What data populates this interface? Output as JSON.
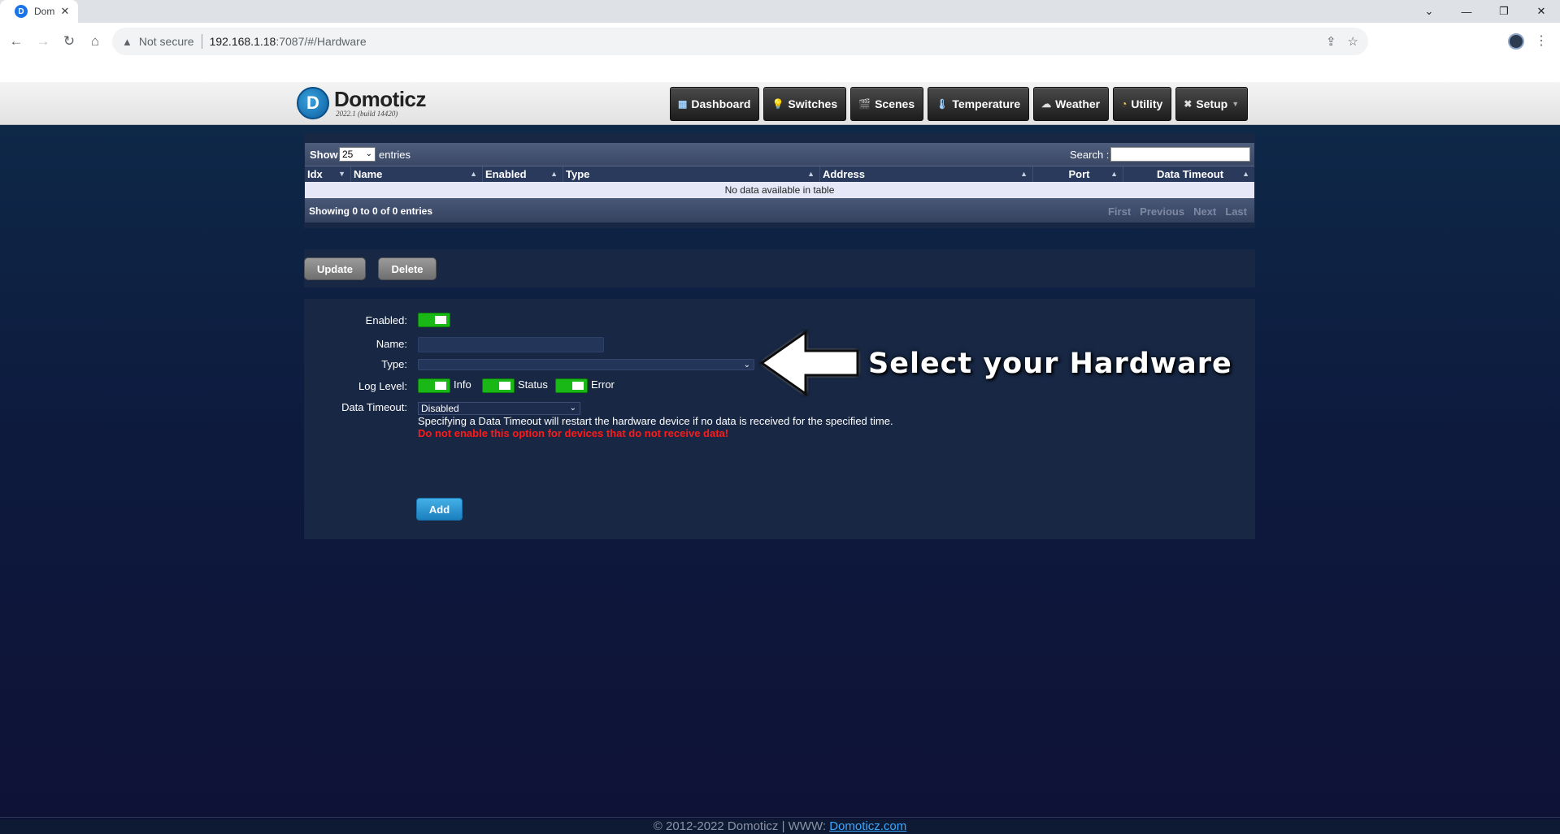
{
  "browser": {
    "tab_title": "Dom",
    "tab_favicon": "D",
    "security_label": "Not secure",
    "url_host": "192.168.1.18",
    "url_path": ":7087/#/Hardware",
    "window_controls": [
      "⌄",
      "—",
      "❐",
      "✕"
    ]
  },
  "header": {
    "logo_mark": "D",
    "logo_name": "Domoticz",
    "version": "2022.1 (build 14420)",
    "menu": [
      {
        "label": "Dashboard",
        "icon": "dashboard-icon",
        "glyph": "▦"
      },
      {
        "label": "Switches",
        "icon": "lightbulb-icon",
        "glyph": "💡"
      },
      {
        "label": "Scenes",
        "icon": "clapperboard-icon",
        "glyph": "🎬"
      },
      {
        "label": "Temperature",
        "icon": "thermometer-icon",
        "glyph": "🌡"
      },
      {
        "label": "Weather",
        "icon": "cloud-icon",
        "glyph": "☁"
      },
      {
        "label": "Utility",
        "icon": "gauge-icon",
        "glyph": "◔"
      },
      {
        "label": "Setup",
        "icon": "tools-icon",
        "glyph": "✖"
      }
    ]
  },
  "table": {
    "show_label": "Show",
    "page_size": "25",
    "entries_label": "entries",
    "search_label": "Search :",
    "columns": [
      "Idx",
      "Name",
      "Enabled",
      "Type",
      "Address",
      "Port",
      "Data Timeout"
    ],
    "empty_message": "No data available in table",
    "info": "Showing 0 to 0 of 0 entries",
    "pager": [
      "First",
      "Previous",
      "Next",
      "Last"
    ]
  },
  "actions": {
    "update_label": "Update",
    "delete_label": "Delete"
  },
  "form": {
    "enabled_label": "Enabled:",
    "name_label": "Name:",
    "type_label": "Type:",
    "log_level_label": "Log Level:",
    "log_info": "Info",
    "log_status": "Status",
    "log_error": "Error",
    "data_timeout_label": "Data Timeout:",
    "data_timeout_value": "Disabled",
    "help_text": "Specifying a Data Timeout will restart the hardware device if no data is received for the specified time.",
    "warning_text": "Do not enable this option for devices that do not receive data!",
    "add_label": "Add"
  },
  "callout": {
    "text": "Select your Hardware"
  },
  "footer": {
    "copyright": "© 2012-2022 Domoticz | WWW: ",
    "link_text": "Domoticz.com"
  },
  "colors": {
    "toggle_on": "#19b817",
    "warning": "#ff1a1a",
    "add_button": "#1b7fbf",
    "background": "#0e1a33"
  }
}
